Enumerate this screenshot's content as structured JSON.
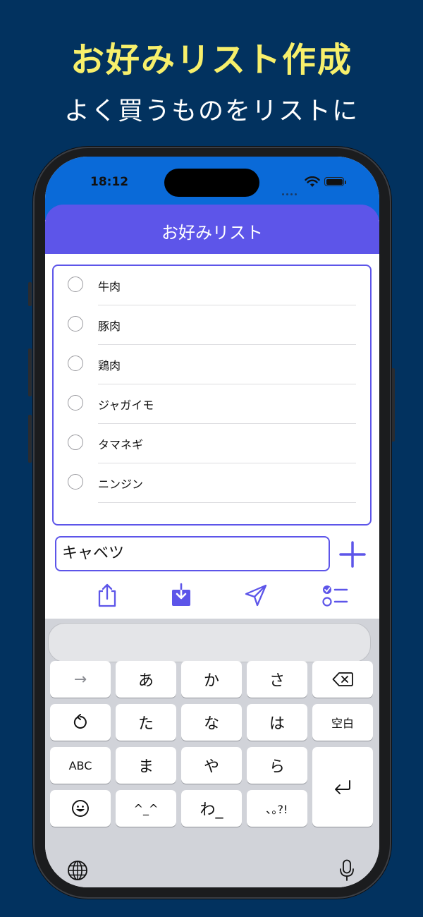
{
  "promo": {
    "headline": "お好みリスト作成",
    "subline": "よく買うものをリストに"
  },
  "status_bar": {
    "time": "18:12",
    "icons": [
      "signal-dots-icon",
      "wifi-icon",
      "battery-icon"
    ]
  },
  "nav": {
    "title": "お好みリスト"
  },
  "list": {
    "items": [
      {
        "label": "牛肉",
        "checked": false
      },
      {
        "label": "豚肉",
        "checked": false
      },
      {
        "label": "鶏肉",
        "checked": false
      },
      {
        "label": "ジャガイモ",
        "checked": false
      },
      {
        "label": "タマネギ",
        "checked": false
      },
      {
        "label": "ニンジン",
        "checked": false
      }
    ]
  },
  "input": {
    "value": "キャベツ"
  },
  "toolbar": {
    "icons": [
      "share-icon",
      "download-icon",
      "send-icon",
      "checklist-icon"
    ]
  },
  "keyboard": {
    "rows": [
      [
        "→",
        "あ",
        "か",
        "さ",
        "⌫"
      ],
      [
        "↺",
        "た",
        "な",
        "は",
        "空白"
      ],
      [
        "ABC",
        "ま",
        "や",
        "ら",
        "⏎"
      ],
      [
        "☺",
        "^_^",
        "わ_",
        "､｡?!"
      ]
    ],
    "bottom_icons": [
      "globe-icon",
      "microphone-icon"
    ]
  },
  "colors": {
    "background": "#02325f",
    "headline": "#f7ef6b",
    "status_bar": "#0a6ad8",
    "accent": "#5d55e9"
  }
}
